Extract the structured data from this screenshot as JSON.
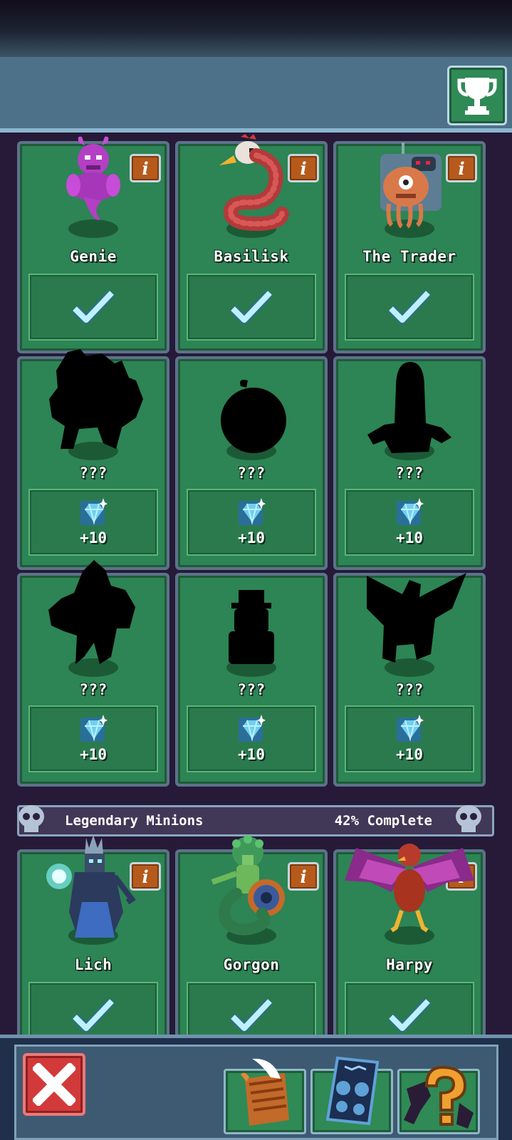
{
  "header": {
    "trophy_icon": "trophy-icon"
  },
  "rows": [
    {
      "cards": [
        {
          "name": "Genie",
          "status": "collected",
          "sprite": "genie"
        },
        {
          "name": "Basilisk",
          "status": "collected",
          "sprite": "basilisk"
        },
        {
          "name": "The Trader",
          "status": "collected",
          "sprite": "trader"
        }
      ]
    },
    {
      "cards": [
        {
          "name": "???",
          "reward": "+10",
          "sprite": "silhouette"
        },
        {
          "name": "???",
          "reward": "+10",
          "sprite": "silhouette"
        },
        {
          "name": "???",
          "reward": "+10",
          "sprite": "silhouette"
        }
      ]
    },
    {
      "cards": [
        {
          "name": "???",
          "reward": "+10",
          "sprite": "silhouette"
        },
        {
          "name": "???",
          "reward": "+10",
          "sprite": "silhouette"
        },
        {
          "name": "???",
          "reward": "+10",
          "sprite": "silhouette"
        }
      ]
    }
  ],
  "legendary": {
    "title": "Legendary Minions",
    "progress": "42% Complete",
    "cards": [
      {
        "name": "Lich",
        "status": "collected",
        "sprite": "lich"
      },
      {
        "name": "Gorgon",
        "status": "collected",
        "sprite": "gorgon"
      },
      {
        "name": "Harpy",
        "status": "collected",
        "sprite": "harpy"
      }
    ]
  },
  "info_label": "i",
  "bottom_nav": {
    "close": "close-icon",
    "scroll": "scroll-quill-icon",
    "spellbook": "rune-tablet-icon",
    "mystery": "question-mark-icon"
  },
  "colors": {
    "card_green": "#2d8454",
    "gem_blue": "#6fd0ef",
    "check_cyan": "#bff0ff",
    "info_orange": "#b65a1c",
    "close_red": "#d23a3a"
  }
}
